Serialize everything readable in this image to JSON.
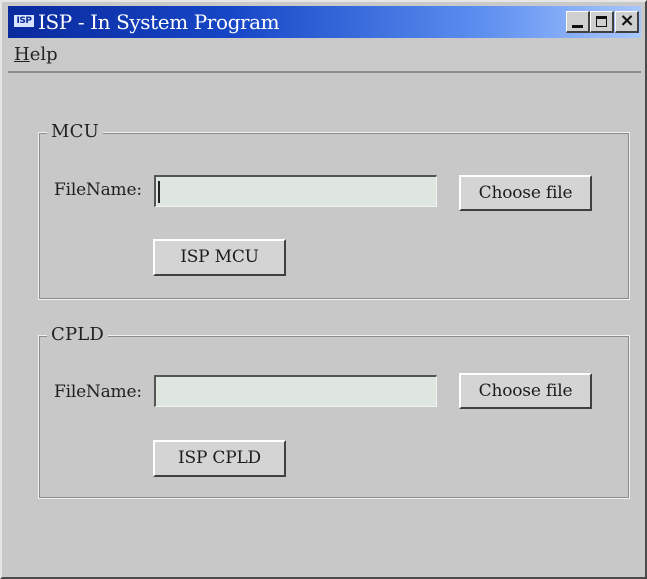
{
  "window": {
    "title": "ISP - In System Program",
    "badge": "ISP"
  },
  "menu": {
    "items": [
      {
        "mnemonic": "H",
        "rest": "elp"
      }
    ]
  },
  "mcu": {
    "group_label": "MCU",
    "filename_label": "FileName:",
    "filename_value": "",
    "choose_button": "Choose file",
    "isp_button": "ISP MCU"
  },
  "cpld": {
    "group_label": "CPLD",
    "filename_label": "FileName:",
    "filename_value": "",
    "choose_button": "Choose file",
    "isp_button": "ISP CPLD"
  },
  "icons": {
    "minimize": "minimize-icon",
    "maximize": "maximize-icon",
    "close": "close-icon"
  },
  "colors": {
    "title_bar_start": "#0a2a9d",
    "title_bar_end": "#a9c7ff",
    "window_bg": "#c9c9c9",
    "input_bg": "#dfe5df"
  }
}
